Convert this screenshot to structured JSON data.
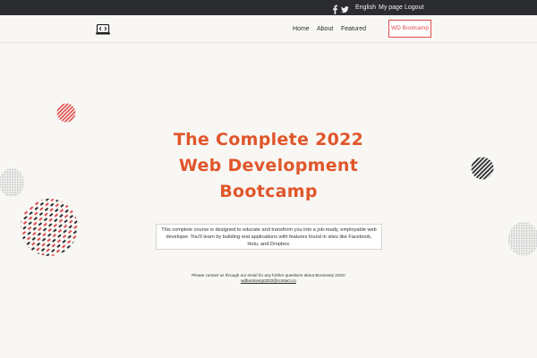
{
  "topbar": {
    "facebook_icon": "facebook-icon",
    "twitter_icon": "twitter-icon",
    "language": "English",
    "my_page": "My page",
    "logout": "Logout"
  },
  "nav": {
    "logo_icon": "code-laptop-icon",
    "links": [
      "Home",
      "About",
      "Featured"
    ],
    "cta": "WD Bootcamp"
  },
  "hero": {
    "title_lines": [
      "The Complete 2022",
      "Web Development",
      "Bootcamp"
    ],
    "description": "This complete course is designed to educate and transform you into a job-ready, employable web developer. You'll learn by building real applications with features found in sites like Facebook, Hulu, and Dropbox.",
    "contact_text": "Please contact us through our email for any further questions about Bootcamp 2022!",
    "contact_email": "wdbootcamp2022@contact.co"
  },
  "colors": {
    "topbar_bg": "#2b2c30",
    "accent": "#e04a4a",
    "title_orange": "#e0562a",
    "background": "#f8f7f4"
  }
}
